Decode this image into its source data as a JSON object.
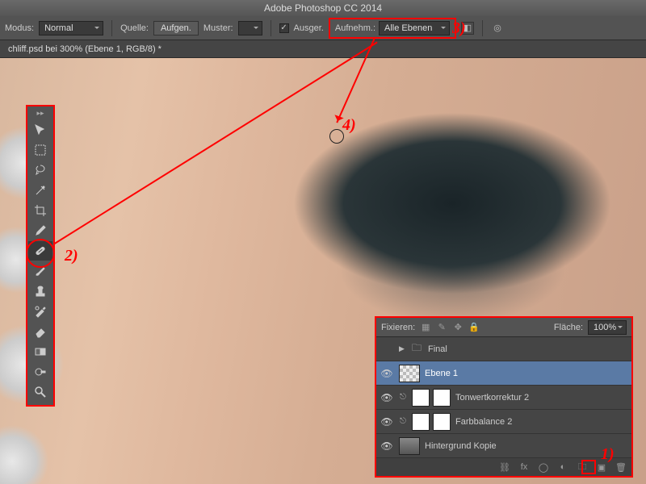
{
  "app": {
    "title": "Adobe Photoshop CC 2014"
  },
  "optionsBar": {
    "modus_label": "Modus:",
    "modus_value": "Normal",
    "quelle_label": "Quelle:",
    "aufgenommen": "Aufgen.",
    "muster": "Muster:",
    "ausger": "Ausger.",
    "aufnehm_label": "Aufnehm.:",
    "aufnehm_value": "Alle Ebenen"
  },
  "tab": {
    "title": "chliff.psd bei 300% (Ebene 1, RGB/8) *"
  },
  "annotations": {
    "a1": "1)",
    "a2": "2)",
    "a3": "3)",
    "a4": "4)"
  },
  "layersPanel": {
    "fixieren": "Fixieren:",
    "flaeche": "Fläche:",
    "flaeche_value": "100%",
    "layers": [
      {
        "name": "Final"
      },
      {
        "name": "Ebene 1"
      },
      {
        "name": "Tonwertkorrektur 2"
      },
      {
        "name": "Farbbalance 2"
      },
      {
        "name": "Hintergrund Kopie"
      }
    ]
  }
}
